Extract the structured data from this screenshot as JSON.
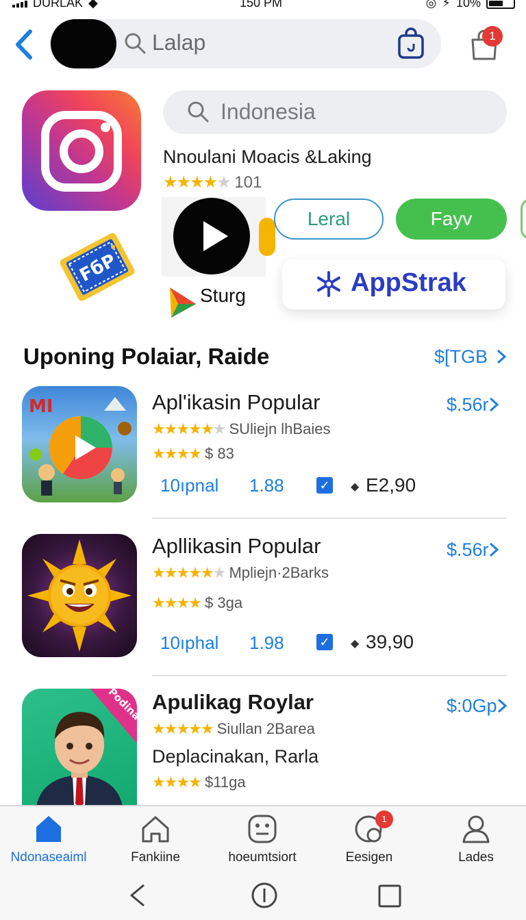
{
  "status_bar": {
    "carrier": "DURLAK",
    "time": "150 PM",
    "battery": "10%"
  },
  "top_bar": {
    "search_text": "Lalap",
    "cart_badge": "1"
  },
  "hero": {
    "search_text": "Indonesia",
    "app_title": "Nnoulani Moacis &Laking",
    "rating_stars": "★★★★",
    "rating_stars_off": "★",
    "rating_count": "101",
    "chip_outline": "Leral",
    "chip_green": "Fayv",
    "video_caption": "Sturg",
    "banner_text": "AppStrak",
    "ticket_text": "FбP"
  },
  "section": {
    "title": "Uponing Polaiar, Raide",
    "link": "$[TGB"
  },
  "apps": [
    {
      "title": "Apl'ikasin Popular",
      "price": "$.56r",
      "stars_a": "★★★★★",
      "stars_a_off": "★",
      "meta_a": "SUliejn lhBaies",
      "stars_b": "★★★★",
      "meta_b": "$ 83",
      "stat_1": "10ıpnal",
      "stat_2": "1.88",
      "total": "E2,90"
    },
    {
      "title": "Apllikasin Popular",
      "price": "$.56r",
      "stars_a": "★★★★★",
      "stars_a_off": "★",
      "meta_a": "Mpliejn·2Barks",
      "stars_b": "★★★★",
      "meta_b": "$ 3ga",
      "stat_1": "10ıphal",
      "stat_2": "1.98",
      "total": "39,90"
    },
    {
      "title": "Apulikag Roylar",
      "price": "$:0Gp",
      "stars_a": "★★★★★",
      "meta_a": "Siullan 2Barea",
      "subtitle": "Deplacinakan, Rarla",
      "stars_b": "★★★★",
      "meta_b": "$11ga",
      "corner_text": "Podina"
    }
  ],
  "tabs": [
    {
      "label": "Ndonaseaiml",
      "active": true
    },
    {
      "label": "Fankiine"
    },
    {
      "label": "hoeumtsiort"
    },
    {
      "label": "Eesigen",
      "badge": "1"
    },
    {
      "label": "Lades"
    }
  ],
  "colors": {
    "accent_blue": "#1d7fe0",
    "star_gold": "#f5b300",
    "chip_green": "#45c04f",
    "badge_red": "#e53935"
  }
}
